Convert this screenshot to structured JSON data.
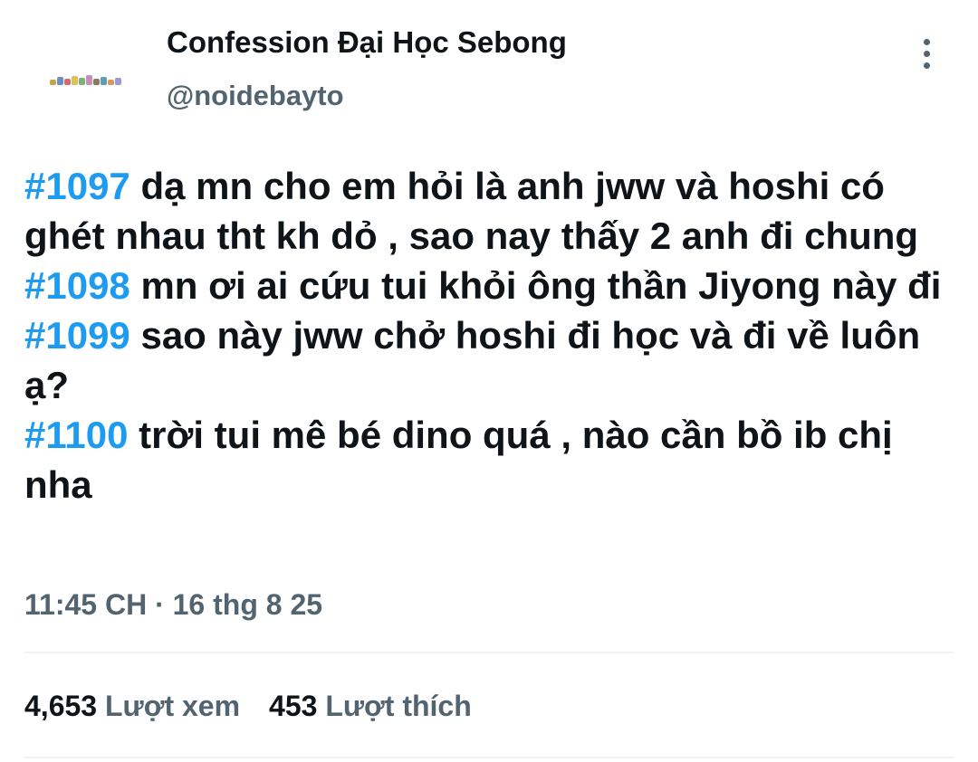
{
  "account": {
    "display_name": "Confession Đại Học Sebong",
    "handle": "@noidebayto"
  },
  "more_icon": "more-vertical-icon",
  "posts": [
    {
      "tag": "#1097",
      "text": " dạ mn cho em hỏi là anh jww và hoshi có ghét nhau tht kh dỏ , sao nay thấy 2 anh đi chung"
    },
    {
      "tag": "#1098",
      "text": " mn ơi ai cứu tui khỏi ông thần Jiyong này đi"
    },
    {
      "tag": "#1099",
      "text": " sao này jww chở hoshi đi học và đi về luôn ạ?"
    },
    {
      "tag": "#1100",
      "text": " trời tui mê bé dino quá , nào cần bồ ib chị nha"
    }
  ],
  "timestamp": "11:45 CH · 16 thg 8 25",
  "stats": {
    "views_count": "4,653",
    "views_label": "Lượt xem",
    "likes_count": "453",
    "likes_label": "Lượt thích"
  },
  "colors": {
    "hashtag": "#1d9bf0",
    "text": "#0f1419",
    "secondary": "#536471",
    "divider": "#eff3f4"
  }
}
